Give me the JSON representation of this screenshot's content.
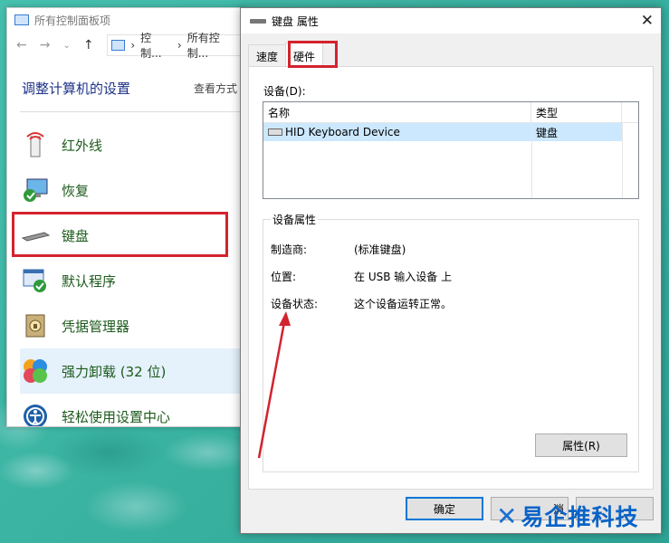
{
  "control_panel": {
    "window_title": "所有控制面板项",
    "breadcrumb": [
      "控制...",
      "所有控制..."
    ],
    "heading": "调整计算机的设置",
    "view_by": "查看方式",
    "items": [
      {
        "label": "红外线",
        "icon": "infrared-icon"
      },
      {
        "label": "恢复",
        "icon": "recovery-icon"
      },
      {
        "label": "键盘",
        "icon": "keyboard-icon"
      },
      {
        "label": "默认程序",
        "icon": "default-programs-icon"
      },
      {
        "label": "凭据管理器",
        "icon": "credential-manager-icon"
      },
      {
        "label": "强力卸载 (32 位)",
        "icon": "uninstaller-icon"
      },
      {
        "label": "轻松使用设置中心",
        "icon": "ease-of-access-icon"
      }
    ]
  },
  "dialog": {
    "title": "键盘 属性",
    "tabs": [
      "速度",
      "硬件"
    ],
    "active_tab": "硬件",
    "devices_label": "设备(D):",
    "table": {
      "headers": [
        "名称",
        "类型"
      ],
      "rows": [
        {
          "name": "HID Keyboard Device",
          "type": "键盘"
        }
      ]
    },
    "group_title": "设备属性",
    "props": [
      {
        "key": "制造商:",
        "value": "(标准键盘)"
      },
      {
        "key": "位置:",
        "value": "在 USB 输入设备 上"
      },
      {
        "key": "设备状态:",
        "value": "这个设备运转正常。"
      }
    ],
    "properties_button": "属性(R)",
    "ok_button": "确定",
    "cancel_button": "消"
  },
  "watermark": "易企推科技",
  "colors": {
    "highlight_red": "#d3232e",
    "selection": "#cce8ff",
    "accent": "#0078d7"
  }
}
